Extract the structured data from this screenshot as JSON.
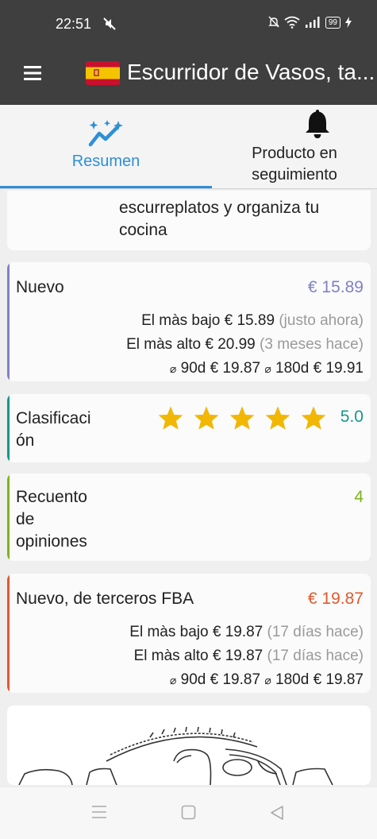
{
  "status_bar": {
    "time": "22:51",
    "battery": "99"
  },
  "app_bar": {
    "title": "Escurridor de Vasos, ta...",
    "flag": "spain-flag"
  },
  "tabs": [
    {
      "label": "Resumen",
      "icon": "trend-sparkle-icon",
      "active": true
    },
    {
      "label": "Producto en seguimiento",
      "icon": "bell-icon",
      "active": false
    }
  ],
  "description": {
    "text": "escurreplatos y organiza tu cocina"
  },
  "nuevo": {
    "label": "Nuevo",
    "price": "€ 15.89",
    "color": "#8080c8",
    "lowest_label": "El màs bajo",
    "lowest_price": "€ 15.89",
    "lowest_when": "(justo ahora)",
    "highest_label": "El màs alto",
    "highest_price": "€ 20.99",
    "highest_when": "(3 meses hace)",
    "avg90_label": "90d",
    "avg90_price": "€ 19.87",
    "avg180_label": "180d",
    "avg180_price": "€ 19.91"
  },
  "rating": {
    "label_line1": "Clasificaci",
    "label_line2": "ón",
    "stars": 5,
    "value": "5.0",
    "color": "#14998a",
    "star_color": "#f2b705"
  },
  "reviews": {
    "label_line1": "Recuento",
    "label_line2": "de",
    "label_line3": "opiniones",
    "value": "4",
    "color": "#7cb31c"
  },
  "fba": {
    "label": "Nuevo, de terceros FBA",
    "price": "€ 19.87",
    "color": "#e2582c",
    "lowest_label": "El màs bajo",
    "lowest_price": "€ 19.87",
    "lowest_when": "(17 días hace)",
    "highest_label": "El màs alto",
    "highest_price": "€ 19.87",
    "highest_when": "(17 días hace)",
    "avg90_label": "90d",
    "avg90_price": "€ 19.87",
    "avg180_label": "180d",
    "avg180_price": "€ 19.87"
  }
}
